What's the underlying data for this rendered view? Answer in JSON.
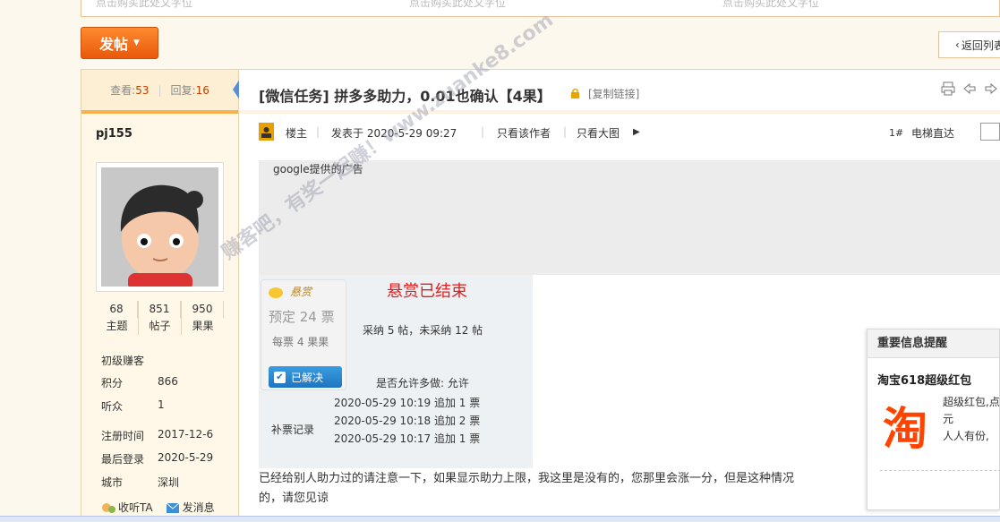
{
  "ad_strip": {
    "texts": [
      "点击购买此处文字位",
      "点击购买此处文字位",
      "点击购买此处文字位"
    ]
  },
  "toolbar": {
    "post_label": "发帖",
    "back_label": "返回列表"
  },
  "thread_stats": {
    "views_label": "查看:",
    "views": "53",
    "replies_label": "回复:",
    "replies": "16"
  },
  "author": {
    "username": "pj155",
    "counts": [
      {
        "value": "68",
        "label": "主题"
      },
      {
        "value": "851",
        "label": "帖子"
      },
      {
        "value": "950",
        "label": "果果"
      }
    ],
    "rank": "初级赚客",
    "points_label": "积分",
    "points": "866",
    "listeners_label": "听众",
    "listeners": "1",
    "register_label": "注册时间",
    "register_date": "2017-12-6",
    "last_login_label": "最后登录",
    "last_login": "2020-5-29",
    "city_label": "城市",
    "city": "深圳",
    "follow_label": "收听TA",
    "message_label": "发消息"
  },
  "thread": {
    "title": "[微信任务] 拼多多助力，0.01也确认【4果】",
    "copy_link": "[复制链接]"
  },
  "post_meta": {
    "op_label": "楼主",
    "posted_at": "发表于 2020-5-29 09:27",
    "only_author": "只看该作者",
    "only_images": "只看大图",
    "floor": "1#",
    "elevator": "电梯直达"
  },
  "google_ad": {
    "label": "google提供的广告"
  },
  "reward": {
    "badge_title": "悬赏",
    "price": "预定 24 票",
    "per_vote": "每票 4 果果",
    "solved_label": "已解决",
    "ended": "悬赏已结束",
    "adopt_summary": "采纳 5 帖，未采纳 12 帖",
    "allow_multiple": "是否允许多做:  允许",
    "supplement_label": "补票记录",
    "records": [
      "2020-05-29 10:19 追加 1 票",
      "2020-05-29 10:18 追加 2 票",
      "2020-05-29 10:17 追加 1 票"
    ]
  },
  "post_body": {
    "line1": "已经给别人助力过的请注意一下，如果显示助力上限，我这里是没有的，您那里会涨一分，但是这种情况",
    "line2": "的，请您见谅"
  },
  "watermark": {
    "text": "赚客吧，有奖一起赚！www.zuanke8.com"
  },
  "popup": {
    "header": "重要信息提醒",
    "title": "淘宝618超级红包",
    "logo_char": "淘",
    "desc": [
      "超级红包,点",
      "元",
      "人人有份,"
    ]
  },
  "colors": {
    "accent_orange": "#f0700c",
    "title_text": "#333333",
    "reward_red": "#e02020",
    "solved_blue": "#1f74c0"
  }
}
